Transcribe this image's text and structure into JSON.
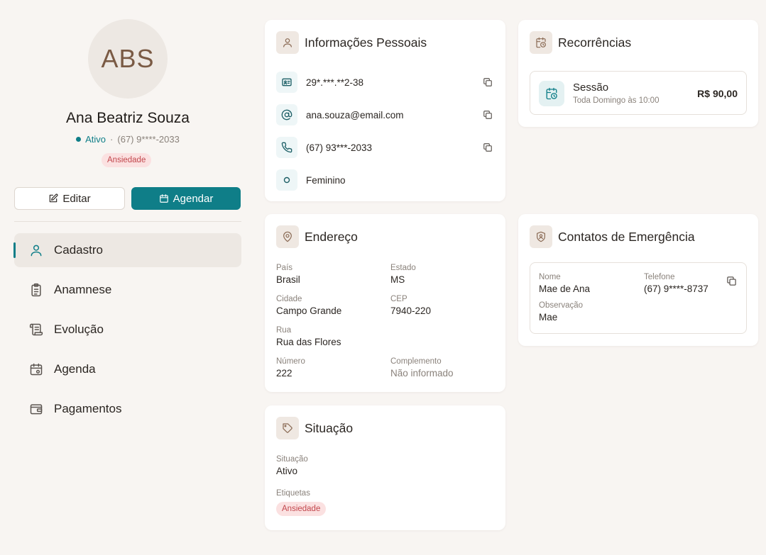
{
  "profile": {
    "initials": "ABS",
    "name": "Ana Beatriz Souza",
    "status": "Ativo",
    "separator": "·",
    "phone": "(67) 9****-2033",
    "tag": "Ansiedade"
  },
  "actions": {
    "edit_label": "Editar",
    "schedule_label": "Agendar"
  },
  "nav": {
    "items": [
      {
        "label": "Cadastro",
        "icon": "user-icon",
        "active": true
      },
      {
        "label": "Anamnese",
        "icon": "clipboard-icon",
        "active": false
      },
      {
        "label": "Evolução",
        "icon": "scroll-icon",
        "active": false
      },
      {
        "label": "Agenda",
        "icon": "calendar-icon",
        "active": false
      },
      {
        "label": "Pagamentos",
        "icon": "wallet-icon",
        "active": false
      }
    ]
  },
  "personal": {
    "title": "Informações Pessoais",
    "document": "29*.***.**2-38",
    "email": "ana.souza@email.com",
    "phone": "(67) 93***-2033",
    "gender": "Feminino"
  },
  "address": {
    "title": "Endereço",
    "country_label": "País",
    "country": "Brasil",
    "state_label": "Estado",
    "state": "MS",
    "city_label": "Cidade",
    "city": "Campo Grande",
    "zip_label": "CEP",
    "zip": "7940-220",
    "street_label": "Rua",
    "street": "Rua das Flores",
    "number_label": "Número",
    "number": "222",
    "complement_label": "Complemento",
    "complement": "Não informado"
  },
  "situation": {
    "title": "Situação",
    "status_label": "Situação",
    "status": "Ativo",
    "tags_label": "Etiquetas",
    "tag": "Ansiedade"
  },
  "recurrences": {
    "title": "Recorrências",
    "item": {
      "name": "Sessão",
      "schedule": "Toda Domingo às 10:00",
      "price": "R$ 90,00"
    }
  },
  "emergency": {
    "title": "Contatos de Emergência",
    "name_label": "Nome",
    "name": "Mae de Ana",
    "phone_label": "Telefone",
    "phone": "(67) 9****-8737",
    "note_label": "Observação",
    "note": "Mae"
  },
  "colors": {
    "accent": "#0f7e88",
    "background": "#f8f5f2",
    "tag_bg": "#fbe1e1",
    "tag_text": "#c2474d"
  }
}
